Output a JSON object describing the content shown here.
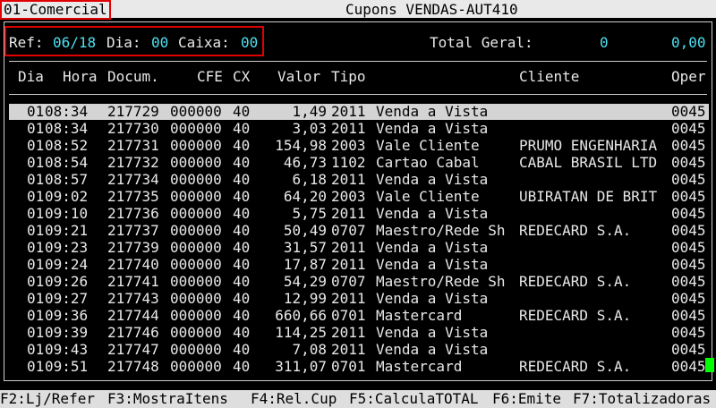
{
  "titlebar": {
    "company": "01-Comercial",
    "title": "Cupons VENDAS-AUT410"
  },
  "filter": {
    "ref_label": "Ref:",
    "ref_value": "06/18",
    "dia_label": "Dia:",
    "dia_value": "00",
    "caixa_label": "Caixa:",
    "caixa_value": "00"
  },
  "total": {
    "label": "Total Geral:",
    "count": "0",
    "amount": "0,00"
  },
  "columns": [
    "Dia",
    "Hora",
    "Docum.",
    "CFE",
    "CX",
    "Valor",
    "Tipo",
    "Cliente",
    "Oper"
  ],
  "rows": [
    [
      "01",
      "08:34",
      "217729",
      "000000",
      "40",
      "1,49",
      "2011",
      "Venda a Vista",
      "",
      "0045"
    ],
    [
      "01",
      "08:34",
      "217730",
      "000000",
      "40",
      "3,03",
      "2011",
      "Venda a Vista",
      "",
      "0045"
    ],
    [
      "01",
      "08:52",
      "217731",
      "000000",
      "40",
      "154,98",
      "2003",
      "Vale Cliente",
      "PRUMO ENGENHARIA",
      "0045"
    ],
    [
      "01",
      "08:54",
      "217732",
      "000000",
      "40",
      "46,73",
      "1102",
      "Cartao Cabal",
      "CABAL BRASIL LTD",
      "0045"
    ],
    [
      "01",
      "08:57",
      "217734",
      "000000",
      "40",
      "6,18",
      "2011",
      "Venda a Vista",
      "",
      "0045"
    ],
    [
      "01",
      "09:02",
      "217735",
      "000000",
      "40",
      "64,20",
      "2003",
      "Vale Cliente",
      "UBIRATAN DE BRIT",
      "0045"
    ],
    [
      "01",
      "09:10",
      "217736",
      "000000",
      "40",
      "5,75",
      "2011",
      "Venda a Vista",
      "",
      "0045"
    ],
    [
      "01",
      "09:21",
      "217737",
      "000000",
      "40",
      "50,49",
      "0707",
      "Maestro/Rede Sh",
      "REDECARD S.A.",
      "0045"
    ],
    [
      "01",
      "09:23",
      "217739",
      "000000",
      "40",
      "31,57",
      "2011",
      "Venda a Vista",
      "",
      "0045"
    ],
    [
      "01",
      "09:24",
      "217740",
      "000000",
      "40",
      "17,87",
      "2011",
      "Venda a Vista",
      "",
      "0045"
    ],
    [
      "01",
      "09:26",
      "217741",
      "000000",
      "40",
      "54,29",
      "0707",
      "Maestro/Rede Sh",
      "REDECARD S.A.",
      "0045"
    ],
    [
      "01",
      "09:27",
      "217743",
      "000000",
      "40",
      "12,99",
      "2011",
      "Venda a Vista",
      "",
      "0045"
    ],
    [
      "01",
      "09:36",
      "217744",
      "000000",
      "40",
      "660,66",
      "0701",
      "Mastercard",
      "REDECARD S.A.",
      "0045"
    ],
    [
      "01",
      "09:39",
      "217746",
      "000000",
      "40",
      "114,25",
      "2011",
      "Venda a Vista",
      "",
      "0045"
    ],
    [
      "01",
      "09:43",
      "217747",
      "000000",
      "40",
      "7,08",
      "2011",
      "Venda a Vista",
      "",
      "0045"
    ],
    [
      "01",
      "09:51",
      "217748",
      "000000",
      "40",
      "311,07",
      "0701",
      "Mastercard",
      "REDECARD S.A.",
      "0045"
    ]
  ],
  "selected_row": 0,
  "functionkeys": [
    "F2:Lj/Refer",
    "F3:MostraItens",
    "F4:Rel.Cup",
    "F5:CalculaTOTAL",
    "F6:Emite",
    "F7:Totalizadoras"
  ]
}
